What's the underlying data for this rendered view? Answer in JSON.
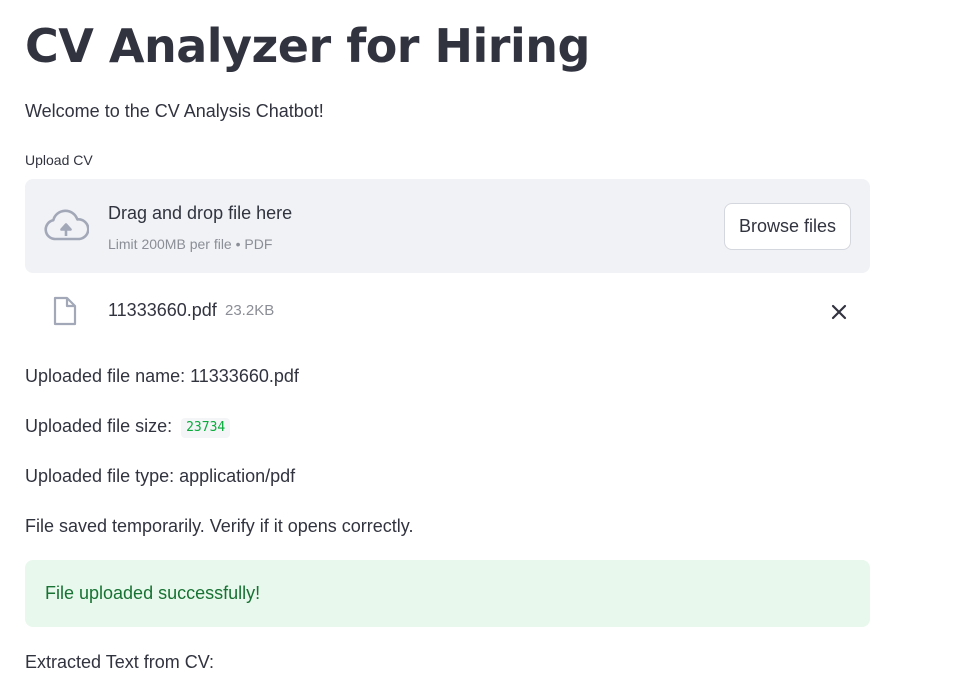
{
  "header": {
    "title": "CV Analyzer for Hiring",
    "welcome": "Welcome to the CV Analysis Chatbot!"
  },
  "uploader": {
    "label": "Upload CV",
    "drop_text": "Drag and drop file here",
    "limit_text": "Limit 200MB per file • PDF",
    "browse_label": "Browse files",
    "upload_icon": "cloud-upload-icon"
  },
  "uploaded_file": {
    "name": "11333660.pdf",
    "size": "23.2KB",
    "file_icon": "file-icon",
    "remove_icon": "close-icon"
  },
  "info": {
    "file_name_line": "Uploaded file name: 11333660.pdf",
    "file_size_prefix": "Uploaded file size:",
    "file_size_value": "23734",
    "file_type_line": "Uploaded file type: application/pdf",
    "saved_line": "File saved temporarily. Verify if it opens correctly."
  },
  "alert": {
    "message": "File uploaded successfully!",
    "background": "#e8f8ec",
    "text_color": "#177233"
  },
  "extracted": {
    "heading": "Extracted Text from CV:"
  },
  "colors": {
    "text": "#31333f",
    "muted": "#8b8e97",
    "dropzone_bg": "#f0f2f6",
    "code_green": "#09ab3b"
  }
}
